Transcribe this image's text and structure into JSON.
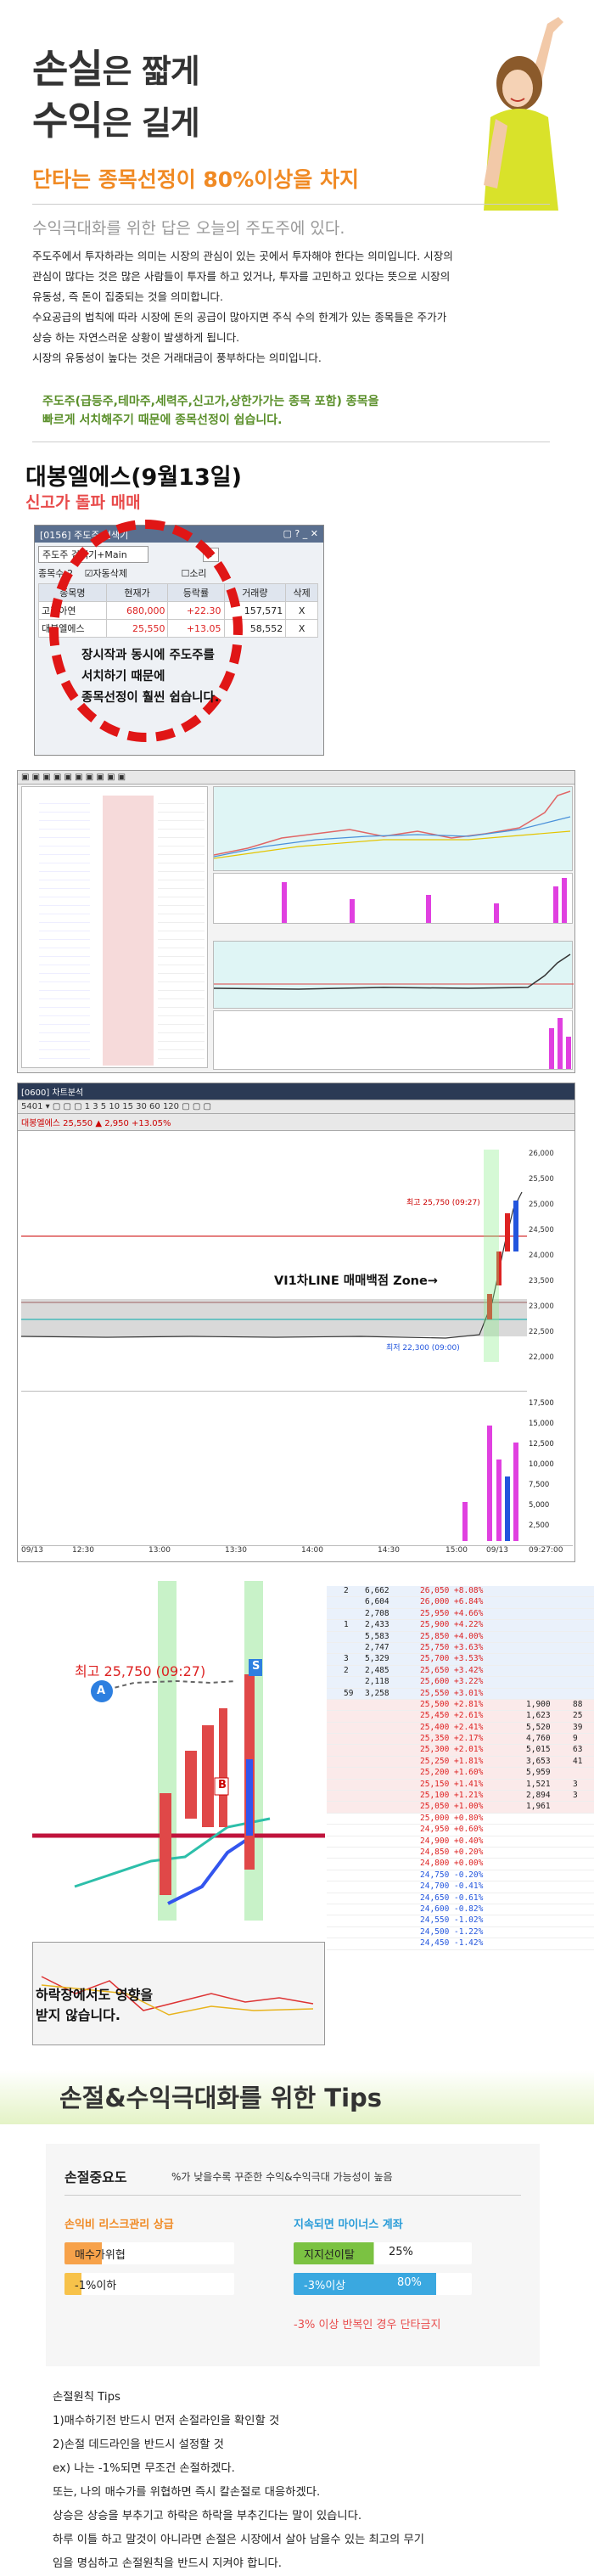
{
  "hero": {
    "line1_big": "손실",
    "line1_small": "은 짧게",
    "line2_big": "수익",
    "line2_small": "은 길게",
    "highlight": "단타는 종목선정이 80%이상을 차지",
    "subtitle": "수익극대화를 위한 답은 오늘의 주도주에 있다.",
    "paragraph": [
      "주도주에서 투자하라는 의미는 시장의 관심이 있는 곳에서 투자해야 한다는 의미입니다. 시장의",
      "관심이 많다는 것은 많은 사람들이 투자를 하고 있거나, 투자를 고민하고 있다는 뜻으로 시장의",
      "유동성, 즉 돈이 집중되는 것을 의미합니다.",
      "수요공급의 법칙에 따라 시장에 돈의 공급이 많아지면 주식 수의 한계가 있는 종목들은 주가가",
      "상승 하는 자연스러운 상황이 발생하게 됩니다.",
      "시장의 유동성이 높다는 것은 거래대금이 풍부하다는 의미입니다."
    ],
    "green_note_1": "주도주(급등주,테마주,세력주,신고가,상한가가는 종목 포함) 종목을",
    "green_note_2": "빠르게 서치해주기 때문에 종목선정이 쉽습니다."
  },
  "case": {
    "title": "대봉엘에스(9월13일)",
    "subtitle": "신고가 돌파 매매"
  },
  "hts_window": {
    "title": "[0156] 주도주 검색기",
    "search_label": "주도주 검색기+Main",
    "count_label": "종목수:2",
    "auto_delete": "자동삭제",
    "sound": "소리",
    "columns": [
      "종목명",
      "현재가",
      "등락률",
      "거래량",
      "삭제"
    ],
    "rows": [
      {
        "name": "고려아연",
        "price": "680,000",
        "rate": "+22.30",
        "vol": "157,571",
        "del": "X"
      },
      {
        "name": "대봉엘에스",
        "price": "25,550",
        "rate": "+13.05",
        "vol": "58,552",
        "del": "X"
      }
    ],
    "overlay": [
      "장시작과 동시에 주도주를",
      "서치하기 때문에",
      "종목선정이 훨씬 쉽습니다."
    ]
  },
  "chart2": {
    "title": "[0600] 차트분석",
    "header_info": "대봉엘에스  25,550  ▲ 2,950  +13.05%",
    "callout": "VI1차LINE 매매백점 Zone→",
    "high_label": "최고 25,750 (09:27)",
    "low_label": "최저 22,300 (09:00)",
    "y_ticks": [
      "26,000",
      "25,500",
      "25,000",
      "24,500",
      "24,000",
      "23,500",
      "23,000",
      "22,500",
      "22,000"
    ],
    "vol_ticks": [
      "17,500",
      "15,000",
      "12,500",
      "10,000",
      "7,500",
      "5,000",
      "2,500"
    ],
    "x_ticks": [
      "09/13",
      "12:30",
      "13:00",
      "13:30",
      "14:00",
      "14:30",
      "15:00",
      "09/13",
      "09:27:00"
    ]
  },
  "chart3": {
    "high_label": "최고 25,750 (09:27)",
    "badge_s": "S",
    "badge_b": "B",
    "badge_a": "A",
    "overlay": [
      "하락장에서도 영향을",
      "받지 않습니다."
    ]
  },
  "orderbook": {
    "rows": [
      [
        "2",
        "6,662",
        "26,050",
        "+8.08%",
        "",
        ""
      ],
      [
        "",
        "6,604",
        "26,000",
        "+6.84%",
        "",
        ""
      ],
      [
        "",
        "2,708",
        "25,950",
        "+4.66%",
        "",
        ""
      ],
      [
        "1",
        "2,433",
        "25,900",
        "+4.22%",
        "",
        ""
      ],
      [
        "",
        "5,583",
        "25,850",
        "+4.00%",
        "",
        ""
      ],
      [
        "",
        "2,747",
        "25,750",
        "+3.63%",
        "",
        ""
      ],
      [
        "3",
        "5,329",
        "25,700",
        "+3.53%",
        "",
        ""
      ],
      [
        "2",
        "2,485",
        "25,650",
        "+3.42%",
        "",
        ""
      ],
      [
        "",
        "2,118",
        "25,600",
        "+3.22%",
        "",
        ""
      ],
      [
        "59",
        "3,258",
        "25,550",
        "+3.01%",
        "",
        ""
      ],
      [
        "",
        "",
        "25,500",
        "+2.81%",
        "1,900",
        "88"
      ],
      [
        "",
        "",
        "25,450",
        "+2.61%",
        "1,623",
        "25"
      ],
      [
        "",
        "",
        "25,400",
        "+2.41%",
        "5,520",
        "39"
      ],
      [
        "",
        "",
        "25,350",
        "+2.17%",
        "4,760",
        "9"
      ],
      [
        "",
        "",
        "25,300",
        "+2.01%",
        "5,015",
        "63"
      ],
      [
        "",
        "",
        "25,250",
        "+1.81%",
        "3,653",
        "41"
      ],
      [
        "",
        "",
        "25,200",
        "+1.60%",
        "5,959",
        ""
      ],
      [
        "",
        "",
        "25,150",
        "+1.41%",
        "1,521",
        "3"
      ],
      [
        "",
        "",
        "25,100",
        "+1.21%",
        "2,894",
        "3"
      ],
      [
        "",
        "",
        "25,050",
        "+1.00%",
        "1,961",
        ""
      ],
      [
        "",
        "",
        "25,000",
        "+0.80%",
        "",
        ""
      ],
      [
        "",
        "",
        "24,950",
        "+0.60%",
        "",
        ""
      ],
      [
        "",
        "",
        "24,900",
        "+0.40%",
        "",
        ""
      ],
      [
        "",
        "",
        "24,850",
        "+0.20%",
        "",
        ""
      ],
      [
        "",
        "",
        "24,800",
        "+0.00%",
        "",
        ""
      ],
      [
        "",
        "",
        "24,750",
        "-0.20%",
        "",
        ""
      ],
      [
        "",
        "",
        "24,700",
        "-0.41%",
        "",
        ""
      ],
      [
        "",
        "",
        "24,650",
        "-0.61%",
        "",
        ""
      ],
      [
        "",
        "",
        "24,600",
        "-0.82%",
        "",
        ""
      ],
      [
        "",
        "",
        "24,550",
        "-1.02%",
        "",
        ""
      ],
      [
        "",
        "",
        "24,500",
        "-1.22%",
        "",
        ""
      ],
      [
        "",
        "",
        "24,450",
        "-1.42%",
        "",
        ""
      ]
    ]
  },
  "tips": {
    "title": "손절&수익극대화를 위한 Tips",
    "importance_label": "손절중요도",
    "importance_desc": "%가 낮을수록 꾸준한 수익&수익극대 가능성이 높음",
    "left_head": "손익비 리스크관리 상급",
    "left_pill_1": "매수가위협",
    "left_pill_2": "-1%이하",
    "right_head": "지속되면 마이너스 계좌",
    "right_pill_1": "지지선이탈",
    "right_val_1": "25%",
    "right_pill_2": "-3%이상",
    "right_val_2": "80%",
    "warning": "-3% 이상 반복인 경우 단타금지",
    "principles_title": "손절원칙 Tips",
    "principles": [
      "1)매수하기전 반드시 먼저 손절라인을 확인할 것",
      "2)손절 데드라인을 반드시 설정할 것",
      "ex) 나는 -1%되면 무조건 손절하겠다.",
      "또는, 나의 매수가를 위협하면 즉시 칼손절로 대응하겠다.",
      "상승은 상승을 부추기고 하락은 하락을 부추긴다는 말이 있습니다.",
      "하루 이틀 하고 말것이 아니라면 손절은 시장에서 살아 남을수 있는 최고의 무기",
      "임을 명심하고 손절원칙을 반드시 지켜야 합니다."
    ]
  }
}
